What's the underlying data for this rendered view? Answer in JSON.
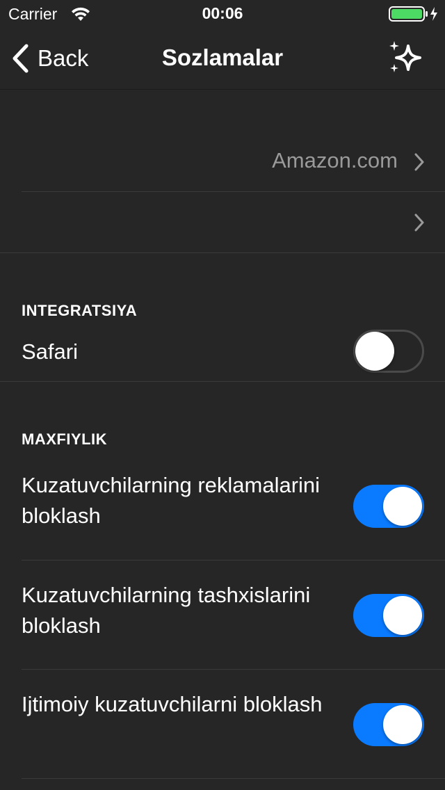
{
  "status_bar": {
    "carrier": "Carrier",
    "time": "00:06",
    "battery_color": "#4cd964"
  },
  "nav": {
    "back_label": "Back",
    "title": "Sozlamalar",
    "action_icon": "sparkles-icon"
  },
  "rows": {
    "search_engine_value": "Amazon.com",
    "second_value": ""
  },
  "integration": {
    "header": "INTEGRATSIYA",
    "safari_label": "Safari",
    "safari_enabled": false
  },
  "privacy": {
    "header": "MAXFIYLIK",
    "items": [
      {
        "label": "Kuzatuvchilarning reklamalarini bloklash",
        "enabled": true
      },
      {
        "label": "Kuzatuvchilarning tashxislarini bloklash",
        "enabled": true
      },
      {
        "label": "Ijtimoiy kuzatuvchilarni bloklash",
        "enabled": true
      }
    ]
  },
  "colors": {
    "background": "#262626",
    "accent": "#0a7aff",
    "separator": "#3a3a3a",
    "secondary_text": "#9a9a9a"
  }
}
